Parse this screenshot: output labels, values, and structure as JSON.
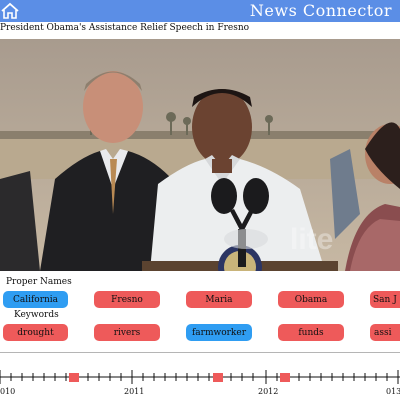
{
  "header": {
    "app_title": "News Connector",
    "home_icon": "home-icon",
    "background": "#5b8ee6"
  },
  "video": {
    "title": "President Obama's Assistance Relief Speech in Fresno",
    "watermark": "lite"
  },
  "proper_names": {
    "label": "Proper Names",
    "items": [
      {
        "label": "California",
        "selected": true
      },
      {
        "label": "Fresno",
        "selected": false
      },
      {
        "label": "Maria",
        "selected": false
      },
      {
        "label": "Obama",
        "selected": false
      },
      {
        "label": "San J",
        "selected": false
      }
    ]
  },
  "keywords": {
    "label": "Keywords",
    "items": [
      {
        "label": "drought",
        "selected": false
      },
      {
        "label": "rivers",
        "selected": false
      },
      {
        "label": "farmworker",
        "selected": true
      },
      {
        "label": "funds",
        "selected": false
      },
      {
        "label": "assi",
        "selected": false
      }
    ]
  },
  "colors": {
    "chip_default": "#ee5a5a",
    "chip_selected": "#2f9df2",
    "timeline_marker": "#ee5a5a"
  },
  "timeline": {
    "year_labels": [
      "010",
      "2011",
      "2012",
      "013"
    ]
  }
}
